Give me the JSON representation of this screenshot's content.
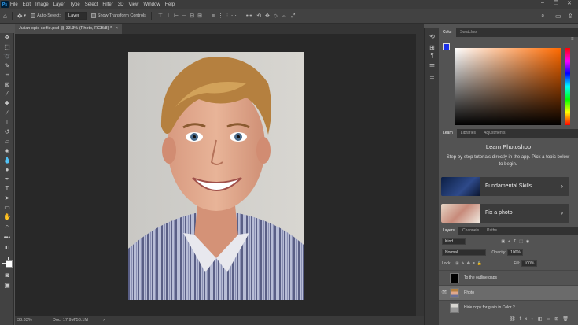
{
  "menu": {
    "logo": "Ps",
    "items": [
      "File",
      "Edit",
      "Image",
      "Layer",
      "Type",
      "Select",
      "Filter",
      "3D",
      "View",
      "Window",
      "Help"
    ],
    "window_controls": [
      "–",
      "❐",
      "✕"
    ]
  },
  "options": {
    "auto_select_label": "Auto-Select:",
    "auto_select_value": "Layer",
    "show_transform_label": "Show Transform Controls"
  },
  "document": {
    "tab_title": "Julian opie selfie.psd @ 33.3% (Photo, RGB/8) *",
    "close": "×",
    "zoom": "33.33%",
    "doc_info": "Doc: 17.9M/58.1M"
  },
  "color_panel": {
    "tabs": [
      "Color",
      "Swatches"
    ],
    "foreground": "#1a2fe6",
    "background": "#ffffff"
  },
  "learn_panel": {
    "tabs": [
      "Learn",
      "Libraries",
      "Adjustments"
    ],
    "title": "Learn Photoshop",
    "description": "Step by-step tutorials directly in the app. Pick a topic below to begin.",
    "cards": [
      {
        "label": "Fundamental Skills",
        "chevron": "›"
      },
      {
        "label": "Fix a photo",
        "chevron": "›"
      }
    ]
  },
  "layers_panel": {
    "tabs": [
      "Layers",
      "Channels",
      "Paths"
    ],
    "filter_kind": "Kind",
    "blend_mode": "Normal",
    "opacity_label": "Opacity:",
    "opacity_value": "100%",
    "lock_label": "Lock:",
    "fill_label": "Fill:",
    "fill_value": "100%",
    "layers": [
      {
        "name": "To the outline gaps",
        "visible": false
      },
      {
        "name": "Photo",
        "visible": true
      },
      {
        "name": "Hide copy for grain in Color 2",
        "visible": false
      }
    ]
  }
}
